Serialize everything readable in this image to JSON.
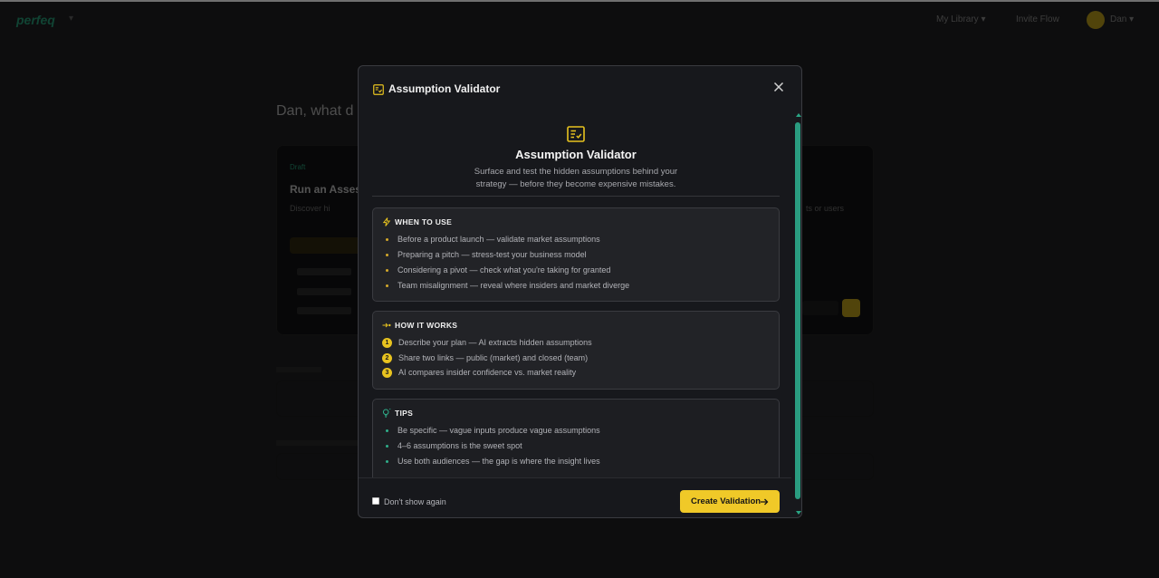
{
  "colors": {
    "accent": "#e8c31f",
    "teal": "#2a9c80",
    "modal_bg": "#17181c",
    "panel_bg": "#222327"
  },
  "modal": {
    "title": "Assumption Validator",
    "close_icon": "close-icon",
    "header_icon": "checklist-icon"
  },
  "hero": {
    "icon": "checklist-icon",
    "title": "Assumption Validator",
    "description": "Surface and test the hidden assumptions behind your strategy — before they become expensive mistakes."
  },
  "when_to_use": {
    "icon": "lightning-icon",
    "title": "WHEN TO USE",
    "items": [
      "Before a product launch — validate market assumptions",
      "Preparing a pitch — stress-test your business model",
      "Considering a pivot — check what you're taking for granted",
      "Team misalignment — reveal where insiders and market diverge"
    ]
  },
  "how_it_works": {
    "icon": "flow-arrow-icon",
    "title": "HOW IT WORKS",
    "steps": [
      {
        "num": "1",
        "text": "Describe your plan — AI extracts hidden assumptions"
      },
      {
        "num": "2",
        "text": "Share two links — public (market) and closed (team)"
      },
      {
        "num": "3",
        "text": "AI compares insider confidence vs. market reality"
      }
    ]
  },
  "tips": {
    "icon": "lightbulb-icon",
    "title": "TIPS",
    "items": [
      "Be specific — vague inputs produce vague assumptions",
      "4–6 assumptions is the sweet spot",
      "Use both audiences — the gap is where the insight lives"
    ]
  },
  "footer": {
    "dont_show_label": "Don't show again",
    "dont_show_checked": false,
    "cta_label": "Create Validation"
  },
  "background": {
    "greeting": "Dan, what d"
  }
}
